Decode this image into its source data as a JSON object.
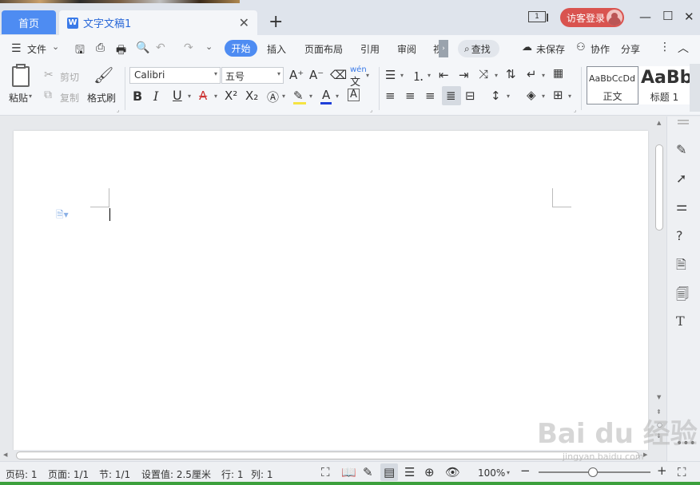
{
  "tabs": {
    "home": "首页",
    "document": "文字文稿1",
    "window_count": "1",
    "guest_login": "访客登录"
  },
  "menu": {
    "file": "文件",
    "items": [
      "开始",
      "插入",
      "页面布局",
      "引用",
      "审阅",
      "视"
    ],
    "find": "查找",
    "unsaved": "未保存",
    "collaborate": "协作",
    "share": "分享"
  },
  "ribbon": {
    "paste": "粘贴",
    "cut": "剪切",
    "copy": "复制",
    "format_painter": "格式刷",
    "font_name": "Calibri",
    "font_size": "五号",
    "pinyin": "wén",
    "styles": [
      {
        "sample": "AaBbCcDd",
        "name": "正文"
      },
      {
        "sample": "AaBb",
        "name": "标题 1"
      }
    ]
  },
  "status": {
    "page_no": "页码: 1",
    "pages": "页面: 1/1",
    "section": "节: 1/1",
    "setting": "设置值: 2.5厘米",
    "line": "行: 1",
    "column": "列: 1",
    "zoom": "100%"
  },
  "watermark": {
    "brand": "Bai du 经验",
    "url": "jingyan.baidu.com"
  },
  "colors": {
    "accent": "#4e8cf2",
    "guest": "#d9534f",
    "font_color_underline": "#1f3fd8"
  }
}
